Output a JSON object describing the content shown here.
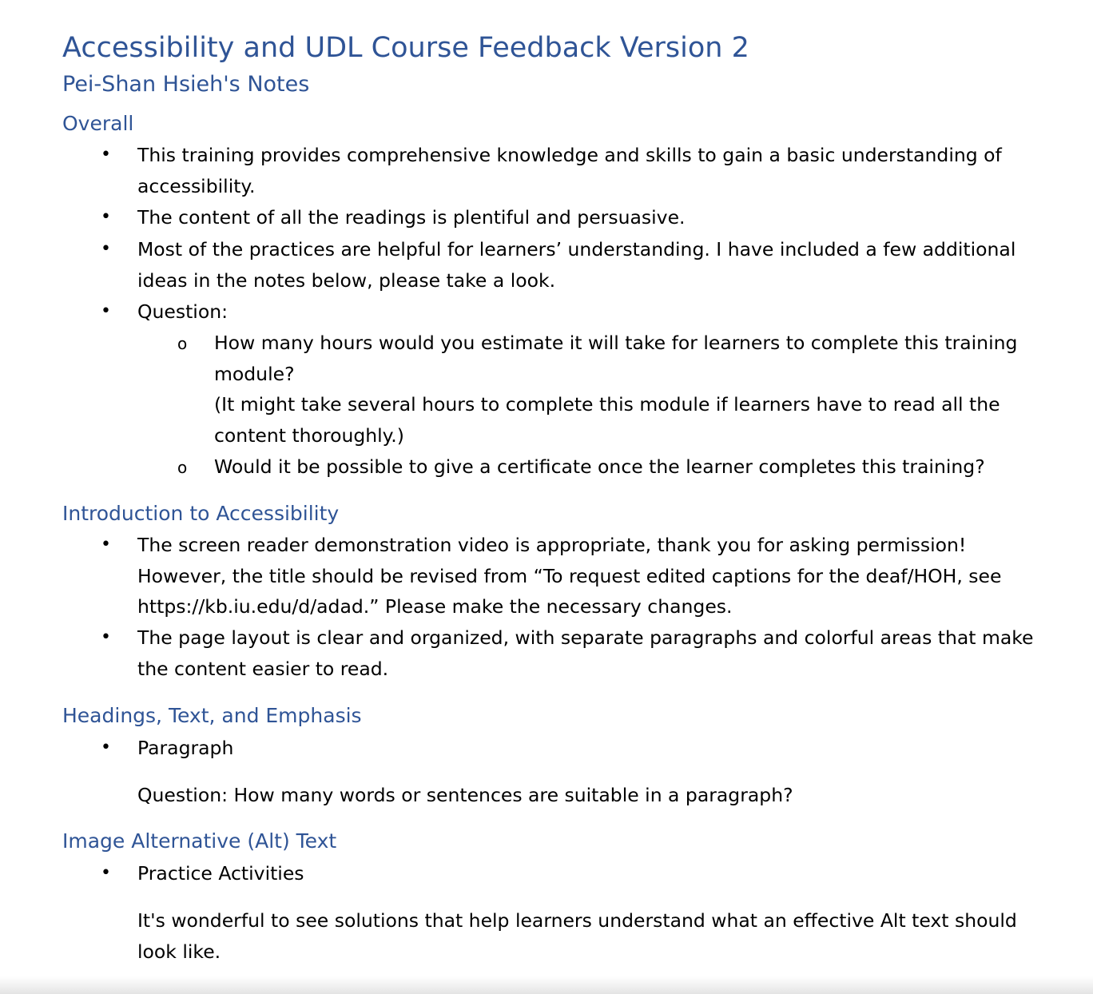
{
  "document": {
    "title": "Accessibility and UDL Course Feedback Version 2",
    "author_heading": "Pei-Shan Hsieh's Notes",
    "bullet_glyph": "•",
    "sub_bullet_glyph": "o",
    "sections": {
      "overall": {
        "heading": "Overall",
        "items": [
          "This training provides comprehensive knowledge and skills to gain a basic understanding of accessibility.",
          "The content of all the readings is plentiful and persuasive.",
          "Most of the practices are helpful for learners’ understanding. I have included a few additional ideas in the notes below, please take a look.",
          "Question:"
        ],
        "questions": [
          "How many hours would you estimate it will take for learners to complete this training module?",
          "(It might take several hours to complete this module if learners have to read all the content thoroughly.)",
          "Would it be possible to give a certificate once the learner completes this training?"
        ]
      },
      "intro": {
        "heading": "Introduction to Accessibility",
        "items": [
          "The screen reader demonstration video is appropriate, thank you for asking permission! However, the title should be revised from “To request edited captions for the deaf/HOH, see https://kb.iu.edu/d/adad.” Please make the necessary changes.",
          "The page layout is clear and organized, with separate paragraphs and colorful areas that make the content easier to read."
        ]
      },
      "headings": {
        "heading": "Headings, Text, and Emphasis",
        "item": "Paragraph",
        "note": "Question: How many words or sentences are suitable in a paragraph?"
      },
      "alt": {
        "heading": "Image Alternative (Alt) Text",
        "item": "Practice Activities",
        "note": "It's wonderful to see solutions that help learners understand what an effective Alt text should look like."
      }
    }
  }
}
